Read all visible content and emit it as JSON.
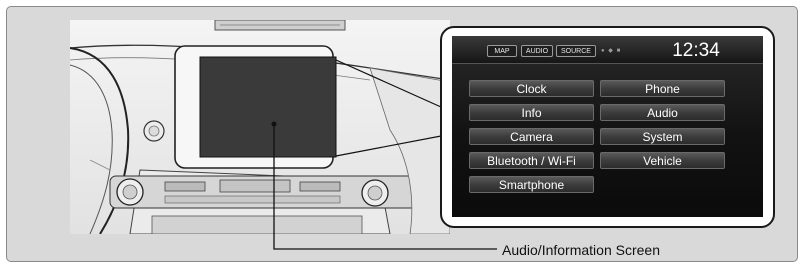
{
  "display": {
    "tabs": [
      {
        "label": "MAP"
      },
      {
        "label": "AUDIO"
      },
      {
        "label": "SOURCE"
      }
    ],
    "status_indicator": "● ◆ ■",
    "time": "12:34"
  },
  "menu": {
    "items": [
      {
        "label": "Clock"
      },
      {
        "label": "Phone"
      },
      {
        "label": "Info"
      },
      {
        "label": "Audio"
      },
      {
        "label": "Camera"
      },
      {
        "label": "System"
      },
      {
        "label": "Bluetooth / Wi-Fi"
      },
      {
        "label": "Vehicle"
      },
      {
        "label": "Smartphone"
      }
    ]
  },
  "callout_label": "Audio/Information Screen"
}
